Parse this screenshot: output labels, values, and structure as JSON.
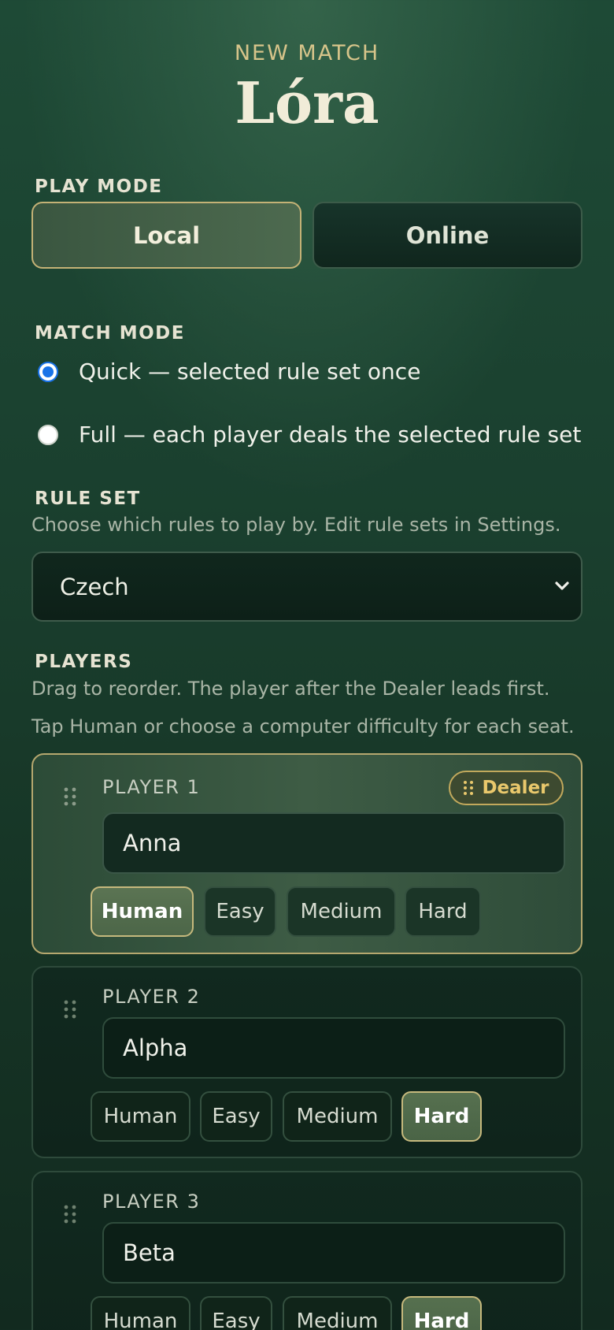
{
  "header": {
    "subtitle": "NEW MATCH",
    "title": "Lóra"
  },
  "play_mode": {
    "label": "PLAY MODE",
    "options": [
      "Local",
      "Online"
    ],
    "selected": "Local"
  },
  "match_mode": {
    "label": "MATCH MODE",
    "options": [
      {
        "label": "Quick — selected rule set once",
        "checked": true
      },
      {
        "label": "Full — each player deals the selected rule set",
        "checked": false
      }
    ]
  },
  "rule_set": {
    "label": "RULE SET",
    "help": "Choose which rules to play by. Edit rule sets in Settings.",
    "value": "Czech"
  },
  "players": {
    "label": "PLAYERS",
    "help1": "Drag to reorder. The player after the Dealer leads first.",
    "help2": "Tap Human or choose a computer difficulty for each seat.",
    "dealer_badge": "Dealer",
    "difficulty_options": [
      "Human",
      "Easy",
      "Medium",
      "Hard"
    ],
    "seats": [
      {
        "label": "PLAYER 1",
        "name": "Anna",
        "selected": "Human",
        "dealer": true
      },
      {
        "label": "PLAYER 2",
        "name": "Alpha",
        "selected": "Hard",
        "dealer": false
      },
      {
        "label": "PLAYER 3",
        "name": "Beta",
        "selected": "Hard",
        "dealer": false
      }
    ]
  }
}
